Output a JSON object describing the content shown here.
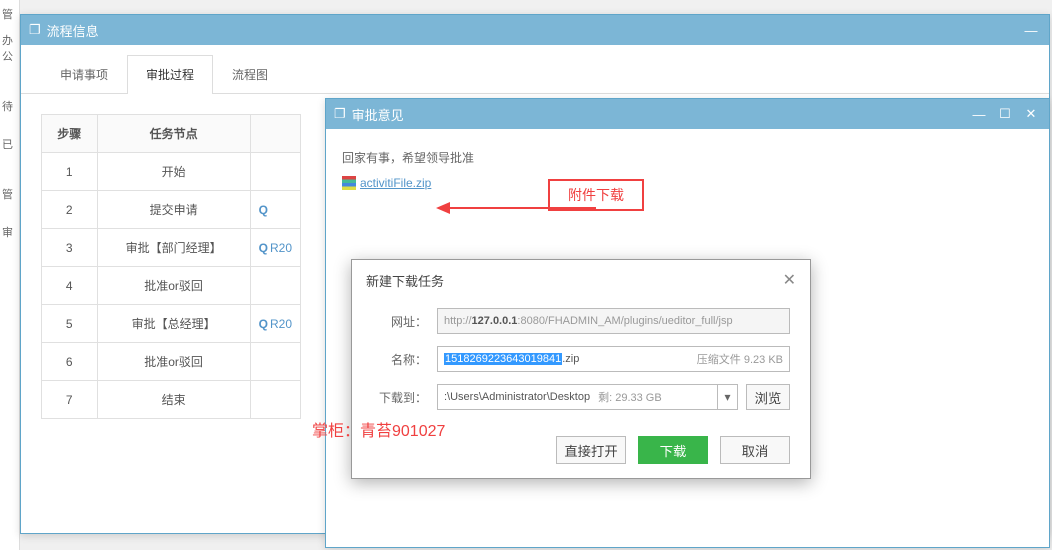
{
  "bg": {
    "t0": "管",
    "t1": "办公",
    "t2": "待",
    "t3": "已",
    "t4": "管",
    "t5": "审"
  },
  "mainWindow": {
    "title": "流程信息"
  },
  "tabs": [
    {
      "label": "申请事项"
    },
    {
      "label": "审批过程"
    },
    {
      "label": "流程图"
    }
  ],
  "table": {
    "headers": {
      "step": "步骤",
      "node": "任务节点",
      "col3": ""
    },
    "rows": [
      {
        "step": "1",
        "node": "开始",
        "link": ""
      },
      {
        "step": "2",
        "node": "提交申请",
        "link": "icon"
      },
      {
        "step": "3",
        "node": "审批【部门经理】",
        "link": "R20"
      },
      {
        "step": "4",
        "node": "批准or驳回",
        "link": ""
      },
      {
        "step": "5",
        "node": "审批【总经理】",
        "link": "R20"
      },
      {
        "step": "6",
        "node": "批准or驳回",
        "link": ""
      },
      {
        "step": "7",
        "node": "结束",
        "link": ""
      }
    ]
  },
  "opinionWindow": {
    "title": "审批意见",
    "text": "回家有事，希望领导批准",
    "fileName": "activitiFile.zip"
  },
  "annotation": {
    "label": "附件下载"
  },
  "downloadDialog": {
    "title": "新建下载任务",
    "labels": {
      "url": "网址：",
      "name": "名称：",
      "saveTo": "下载到："
    },
    "urlPre": "http://",
    "urlHost": "127.0.0.1",
    "urlRest": ":8080/FHADMIN_AM/plugins/ueditor_full/jsp",
    "fileId": "1518269223643019841",
    "fileExt": ".zip",
    "fileMeta": "压缩文件 9.23 KB",
    "savePathPre": ":\\Users\\Administrator\\Desktop",
    "savePathMeta": " 剩: 29.33 GB",
    "browse": "浏览",
    "buttons": {
      "open": "直接打开",
      "download": "下载",
      "cancel": "取消"
    }
  },
  "watermark": "掌柜：青苔901027"
}
